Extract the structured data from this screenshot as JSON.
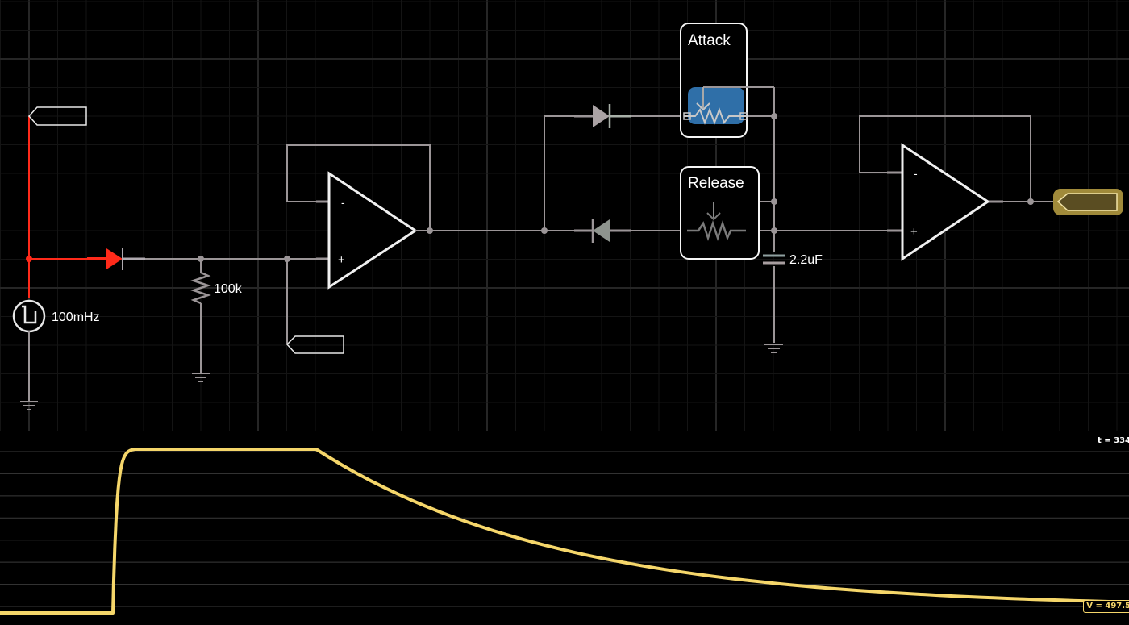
{
  "app": {
    "view": "circuit-simulator"
  },
  "colors": {
    "background": "#000000",
    "wire": "#9b9597",
    "wire_active": "#ff2a1a",
    "component_outline": "#ffffff",
    "selection_blue": "#2f6fa8",
    "probe_gold": "#a08a3a",
    "trace": "#f5d66a",
    "grid_minor": "#141414",
    "grid_major": "#262626"
  },
  "schematic": {
    "source": {
      "type": "square-wave",
      "label": "100mHz"
    },
    "resistor": {
      "label": "100k"
    },
    "capacitor": {
      "label": "2.2uF"
    },
    "attack_control": {
      "label": "Attack",
      "selected": true
    },
    "release_control": {
      "label": "Release",
      "selected": false
    },
    "opamp_1": {
      "minus": "-",
      "plus": "+"
    },
    "opamp_2": {
      "minus": "-",
      "plus": "+"
    },
    "net_labels": [
      {
        "name": "input-probe-label",
        "text": ""
      },
      {
        "name": "buffer-probe-label",
        "text": ""
      },
      {
        "name": "output-probe-label",
        "text": "",
        "highlighted": true
      }
    ]
  },
  "scope": {
    "time_readout": "t = 334",
    "voltage_readout": "V = 497.5",
    "trace": {
      "description": "envelope follower output",
      "segments": [
        {
          "phase": "low",
          "level": 0.0,
          "t_start": 0.0,
          "t_end": 0.1
        },
        {
          "phase": "attack",
          "level_from": 0.0,
          "level_to": 1.0,
          "t_start": 0.1,
          "t_end": 0.12
        },
        {
          "phase": "sustain",
          "level": 1.0,
          "t_start": 0.12,
          "t_end": 0.28
        },
        {
          "phase": "release",
          "level_from": 1.0,
          "level_to": 0.03,
          "t_start": 0.28,
          "t_end": 1.0
        }
      ]
    }
  }
}
